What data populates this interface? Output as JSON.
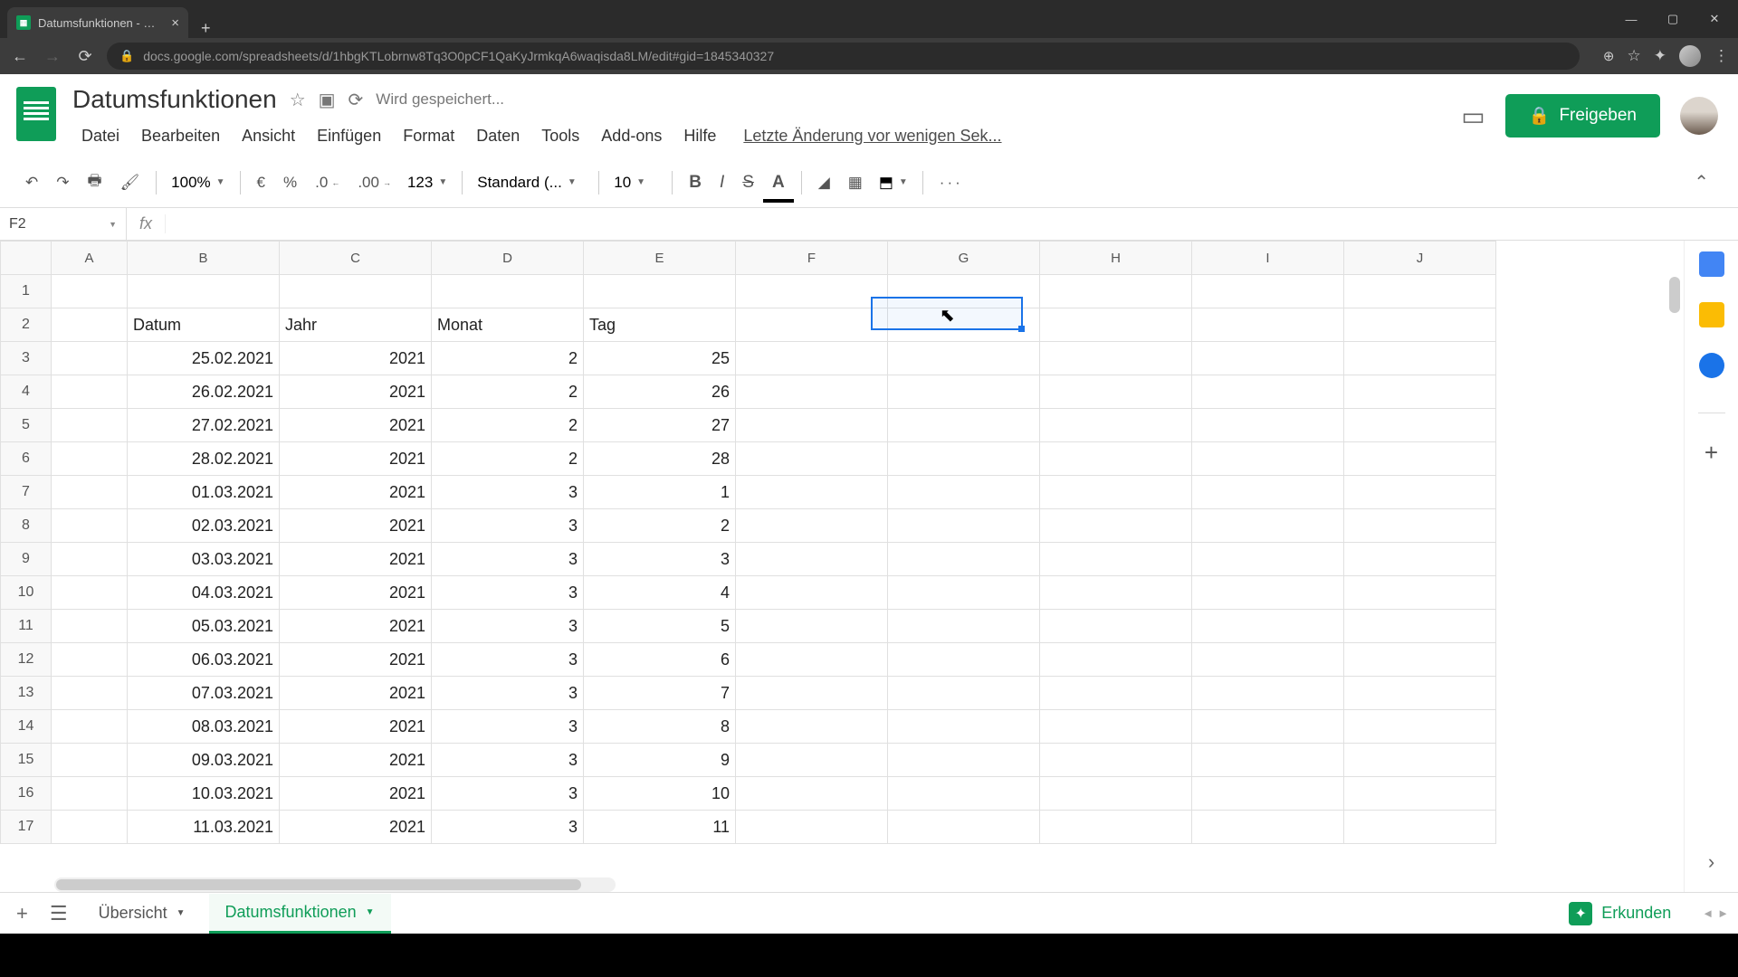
{
  "browser": {
    "tab_title": "Datumsfunktionen - Google Tab",
    "url": "docs.google.com/spreadsheets/d/1hbgKTLobrnw8Tq3O0pCF1QaKyJrmkqA6waqisda8LM/edit#gid=1845340327"
  },
  "doc": {
    "title": "Datumsfunktionen",
    "saving": "Wird gespeichert...",
    "last_edit": "Letzte Änderung vor wenigen Sek..."
  },
  "menus": [
    "Datei",
    "Bearbeiten",
    "Ansicht",
    "Einfügen",
    "Format",
    "Daten",
    "Tools",
    "Add-ons",
    "Hilfe"
  ],
  "toolbar": {
    "zoom": "100%",
    "currency": "€",
    "percent": "%",
    "dec_dec": ".0",
    "inc_dec": ".00",
    "numfmt": "123",
    "font": "Standard (...",
    "font_size": "10",
    "more": "···"
  },
  "formula": {
    "name_box": "F2",
    "fx": "fx",
    "value": ""
  },
  "columns": [
    "A",
    "B",
    "C",
    "D",
    "E",
    "F",
    "G",
    "H",
    "I",
    "J"
  ],
  "row_headers": {
    "b": "Datum",
    "c": "Jahr",
    "d": "Monat",
    "e": "Tag"
  },
  "rows": [
    {
      "n": 1
    },
    {
      "n": 2,
      "b": "Datum",
      "c": "Jahr",
      "d": "Monat",
      "e": "Tag",
      "text": true
    },
    {
      "n": 3,
      "b": "25.02.2021",
      "c": "2021",
      "d": "2",
      "e": "25"
    },
    {
      "n": 4,
      "b": "26.02.2021",
      "c": "2021",
      "d": "2",
      "e": "26"
    },
    {
      "n": 5,
      "b": "27.02.2021",
      "c": "2021",
      "d": "2",
      "e": "27"
    },
    {
      "n": 6,
      "b": "28.02.2021",
      "c": "2021",
      "d": "2",
      "e": "28"
    },
    {
      "n": 7,
      "b": "01.03.2021",
      "c": "2021",
      "d": "3",
      "e": "1"
    },
    {
      "n": 8,
      "b": "02.03.2021",
      "c": "2021",
      "d": "3",
      "e": "2"
    },
    {
      "n": 9,
      "b": "03.03.2021",
      "c": "2021",
      "d": "3",
      "e": "3"
    },
    {
      "n": 10,
      "b": "04.03.2021",
      "c": "2021",
      "d": "3",
      "e": "4"
    },
    {
      "n": 11,
      "b": "05.03.2021",
      "c": "2021",
      "d": "3",
      "e": "5"
    },
    {
      "n": 12,
      "b": "06.03.2021",
      "c": "2021",
      "d": "3",
      "e": "6"
    },
    {
      "n": 13,
      "b": "07.03.2021",
      "c": "2021",
      "d": "3",
      "e": "7"
    },
    {
      "n": 14,
      "b": "08.03.2021",
      "c": "2021",
      "d": "3",
      "e": "8"
    },
    {
      "n": 15,
      "b": "09.03.2021",
      "c": "2021",
      "d": "3",
      "e": "9"
    },
    {
      "n": 16,
      "b": "10.03.2021",
      "c": "2021",
      "d": "3",
      "e": "10"
    },
    {
      "n": 17,
      "b": "11.03.2021",
      "c": "2021",
      "d": "3",
      "e": "11"
    }
  ],
  "selected_cell": "F2",
  "sheets": {
    "overview": "Übersicht",
    "active": "Datumsfunktionen",
    "explore": "Erkunden"
  },
  "share": "Freigeben"
}
